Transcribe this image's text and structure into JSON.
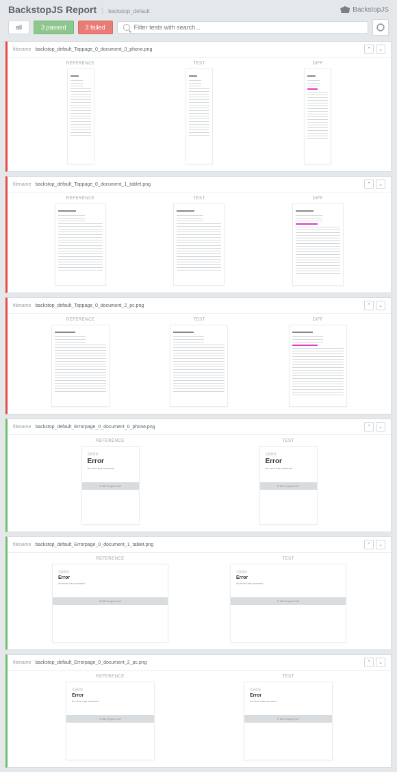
{
  "header": {
    "title": "BackstopJS Report",
    "subtitle": "backstop_default",
    "brand": "BackstopJS"
  },
  "controls": {
    "all": "all",
    "passed": "3 passed",
    "failed": "3 failed",
    "search_placeholder": "Filter tests with search..."
  },
  "labels": {
    "filename": "filename",
    "reference": "REFERENCE",
    "test": "TEST",
    "diff": "DIFF"
  },
  "error_thumb": {
    "breadcrumb": "会員登録",
    "title": "Error",
    "msg": "An error has occurred.",
    "footer": "© NN Project CoP"
  },
  "tests": [
    {
      "status": "fail",
      "filename": "backstop_default_Toppage_0_document_0_phone.png",
      "cols": 3,
      "thumb": "phone"
    },
    {
      "status": "fail",
      "filename": "backstop_default_Toppage_0_document_1_tablet.png",
      "cols": 3,
      "thumb": "tablet"
    },
    {
      "status": "fail",
      "filename": "backstop_default_Toppage_0_document_2_pc.png",
      "cols": 3,
      "thumb": "pc"
    },
    {
      "status": "pass",
      "filename": "backstop_default_Errorpage_0_document_0_phone.png",
      "cols": 2,
      "thumb": "err-phone"
    },
    {
      "status": "pass",
      "filename": "backstop_default_Errorpage_0_document_1_tablet.png",
      "cols": 2,
      "thumb": "err-tablet"
    },
    {
      "status": "pass",
      "filename": "backstop_default_Errorpage_0_document_2_pc.png",
      "cols": 2,
      "thumb": "err-pc"
    }
  ]
}
